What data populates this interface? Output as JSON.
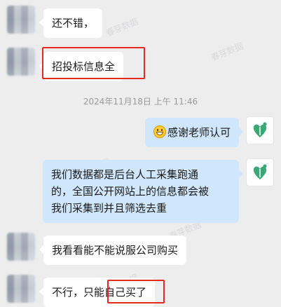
{
  "colors": {
    "background": "#ededed",
    "incoming_bubble": "#ffffff",
    "outgoing_bubble": "#cfe6fb",
    "highlight": "#e8281f",
    "brand_green": "#3aa776"
  },
  "messages": [
    {
      "side": "incoming",
      "text": "还不错，"
    },
    {
      "side": "incoming",
      "text": "招投标信息全",
      "highlighted": true
    },
    {
      "side": "outgoing",
      "emoji": "grin-emoji",
      "text": "感谢老师认可"
    },
    {
      "side": "outgoing",
      "lines": [
        "我们数据都是后台人工采集跑通",
        "的，全国公开网站上的信息都会被",
        "我们采集到并且筛选去重"
      ]
    },
    {
      "side": "incoming",
      "text": "我看看能不能说服公司购买"
    },
    {
      "side": "incoming",
      "text_before": "不行，只能",
      "text_highlight": "自己买了"
    }
  ],
  "timestamp": "2024年11月18日 上午 11:46",
  "watermark": "春芽数据",
  "icons": {
    "brand_logo": "leaf-heart-icon",
    "emoji": "grin-emoji"
  }
}
